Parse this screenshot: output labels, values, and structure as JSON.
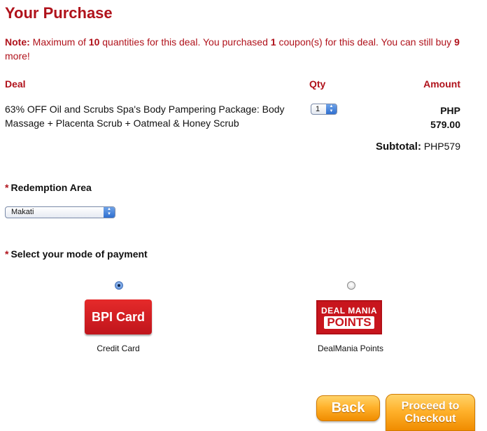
{
  "page": {
    "title": "Your Purchase"
  },
  "note": {
    "label": "Note:",
    "text_1": " Maximum of ",
    "max_qty": "10",
    "text_2": " quantities for this deal. You purchased ",
    "purchased": "1",
    "text_3": " coupon(s) for this deal. You can still buy ",
    "remaining": "9",
    "text_4": " more!"
  },
  "table": {
    "headers": {
      "deal": "Deal",
      "qty": "Qty",
      "amount": "Amount"
    },
    "row": {
      "deal": "63% OFF Oil and Scrubs Spa's Body Pampering Package: Body Massage + Placenta Scrub + Oatmeal & Honey Scrub",
      "qty_selected": "1",
      "currency": "PHP",
      "amount": "579.00"
    },
    "subtotal_label": "Subtotal:",
    "subtotal_value": "PHP579"
  },
  "redemption": {
    "required_mark": "*",
    "label": "Redemption Area",
    "selected": "Makati"
  },
  "payment": {
    "required_mark": "*",
    "label": "Select your mode of payment",
    "options": [
      {
        "logo_text": "BPI Card",
        "label": "Credit Card",
        "selected": true
      },
      {
        "logo_line1": "DEAL MANIA",
        "logo_line2": "POINTS",
        "label": "DealMania Points",
        "selected": false
      }
    ]
  },
  "buttons": {
    "back": "Back",
    "checkout_line1": "Proceed to",
    "checkout_line2": "Checkout"
  },
  "colors": {
    "accent_red": "#b0121b",
    "button_orange": "#ffb22c"
  }
}
